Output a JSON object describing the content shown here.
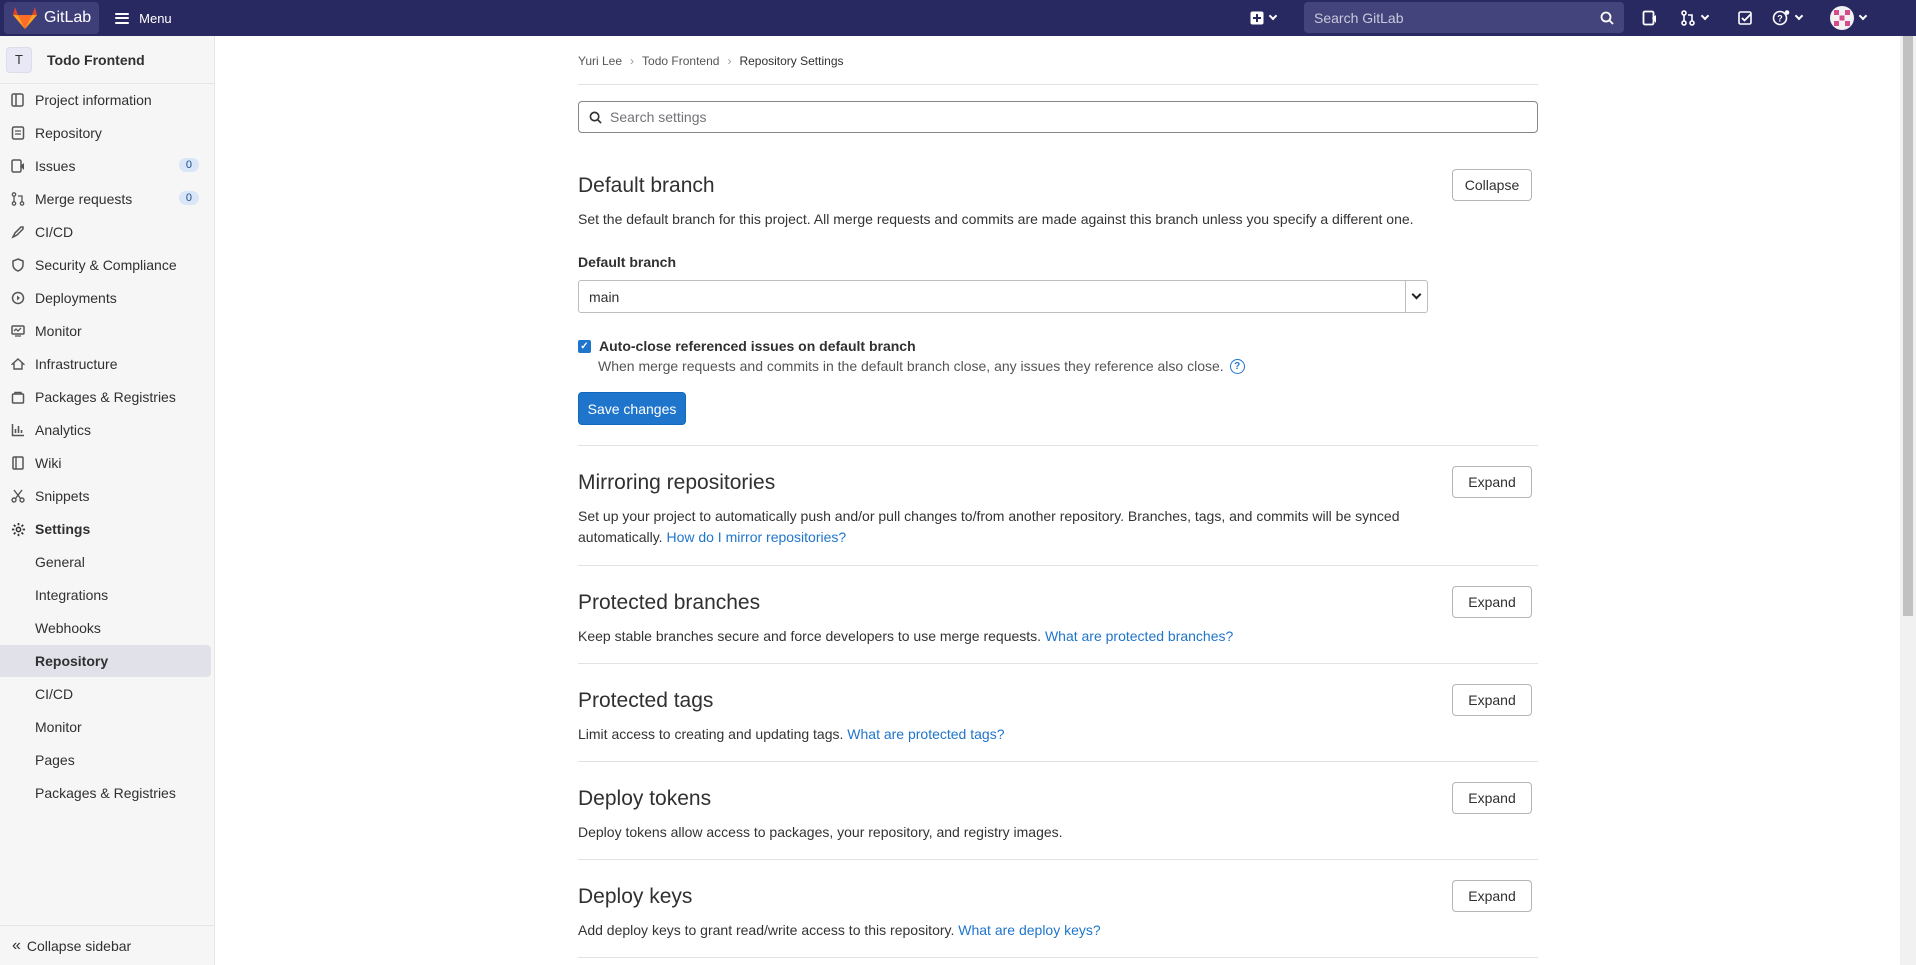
{
  "navbar": {
    "brand": "GitLab",
    "menu_label": "Menu",
    "search_placeholder": "Search GitLab"
  },
  "sidebar": {
    "project_initial": "T",
    "project_name": "Todo Frontend",
    "items": [
      {
        "label": "Project information",
        "icon": "info-doc-icon"
      },
      {
        "label": "Repository",
        "icon": "doc-icon"
      },
      {
        "label": "Issues",
        "icon": "issues-icon",
        "badge": "0"
      },
      {
        "label": "Merge requests",
        "icon": "merge-request-icon",
        "badge": "0"
      },
      {
        "label": "CI/CD",
        "icon": "rocket-icon"
      },
      {
        "label": "Security & Compliance",
        "icon": "shield-icon"
      },
      {
        "label": "Deployments",
        "icon": "deployments-icon"
      },
      {
        "label": "Monitor",
        "icon": "monitor-icon"
      },
      {
        "label": "Infrastructure",
        "icon": "cloud-icon"
      },
      {
        "label": "Packages & Registries",
        "icon": "package-icon"
      },
      {
        "label": "Analytics",
        "icon": "chart-icon"
      },
      {
        "label": "Wiki",
        "icon": "book-icon"
      },
      {
        "label": "Snippets",
        "icon": "scissors-icon"
      },
      {
        "label": "Settings",
        "icon": "gear-icon"
      }
    ],
    "settings_subitems": [
      "General",
      "Integrations",
      "Webhooks",
      "Repository",
      "CI/CD",
      "Monitor",
      "Pages",
      "Packages & Registries"
    ],
    "active_subitem": "Repository",
    "collapse_label": "Collapse sidebar"
  },
  "breadcrumb": [
    "Yuri Lee",
    "Todo Frontend",
    "Repository Settings"
  ],
  "settings_search_placeholder": "Search settings",
  "default_branch": {
    "title": "Default branch",
    "description": "Set the default branch for this project. All merge requests and commits are made against this branch unless you specify a different one.",
    "collapse_label": "Collapse",
    "field_label": "Default branch",
    "selected_branch": "main",
    "auto_close_checked": true,
    "auto_close_label": "Auto-close referenced issues on default branch",
    "auto_close_help": "When merge requests and commits in the default branch close, any issues they reference also close.",
    "save_label": "Save changes"
  },
  "sections": [
    {
      "title": "Mirroring repositories",
      "description": "Set up your project to automatically push and/or pull changes to/from another repository. Branches, tags, and commits will be synced",
      "description2": "automatically.",
      "link": "How do I mirror repositories?",
      "button": "Expand"
    },
    {
      "title": "Protected branches",
      "description": "Keep stable branches secure and force developers to use merge requests.",
      "link": "What are protected branches?",
      "button": "Expand"
    },
    {
      "title": "Protected tags",
      "description": "Limit access to creating and updating tags.",
      "link": "What are protected tags?",
      "button": "Expand"
    },
    {
      "title": "Deploy tokens",
      "description": "Deploy tokens allow access to packages, your repository, and registry images.",
      "button": "Expand"
    },
    {
      "title": "Deploy keys",
      "description": "Add deploy keys to grant read/write access to this repository.",
      "link": "What are deploy keys?",
      "button": "Expand"
    }
  ],
  "colors": {
    "navbar": "#292961",
    "accent": "#1f75cb",
    "sidebar_bg": "#f6f6f6"
  }
}
